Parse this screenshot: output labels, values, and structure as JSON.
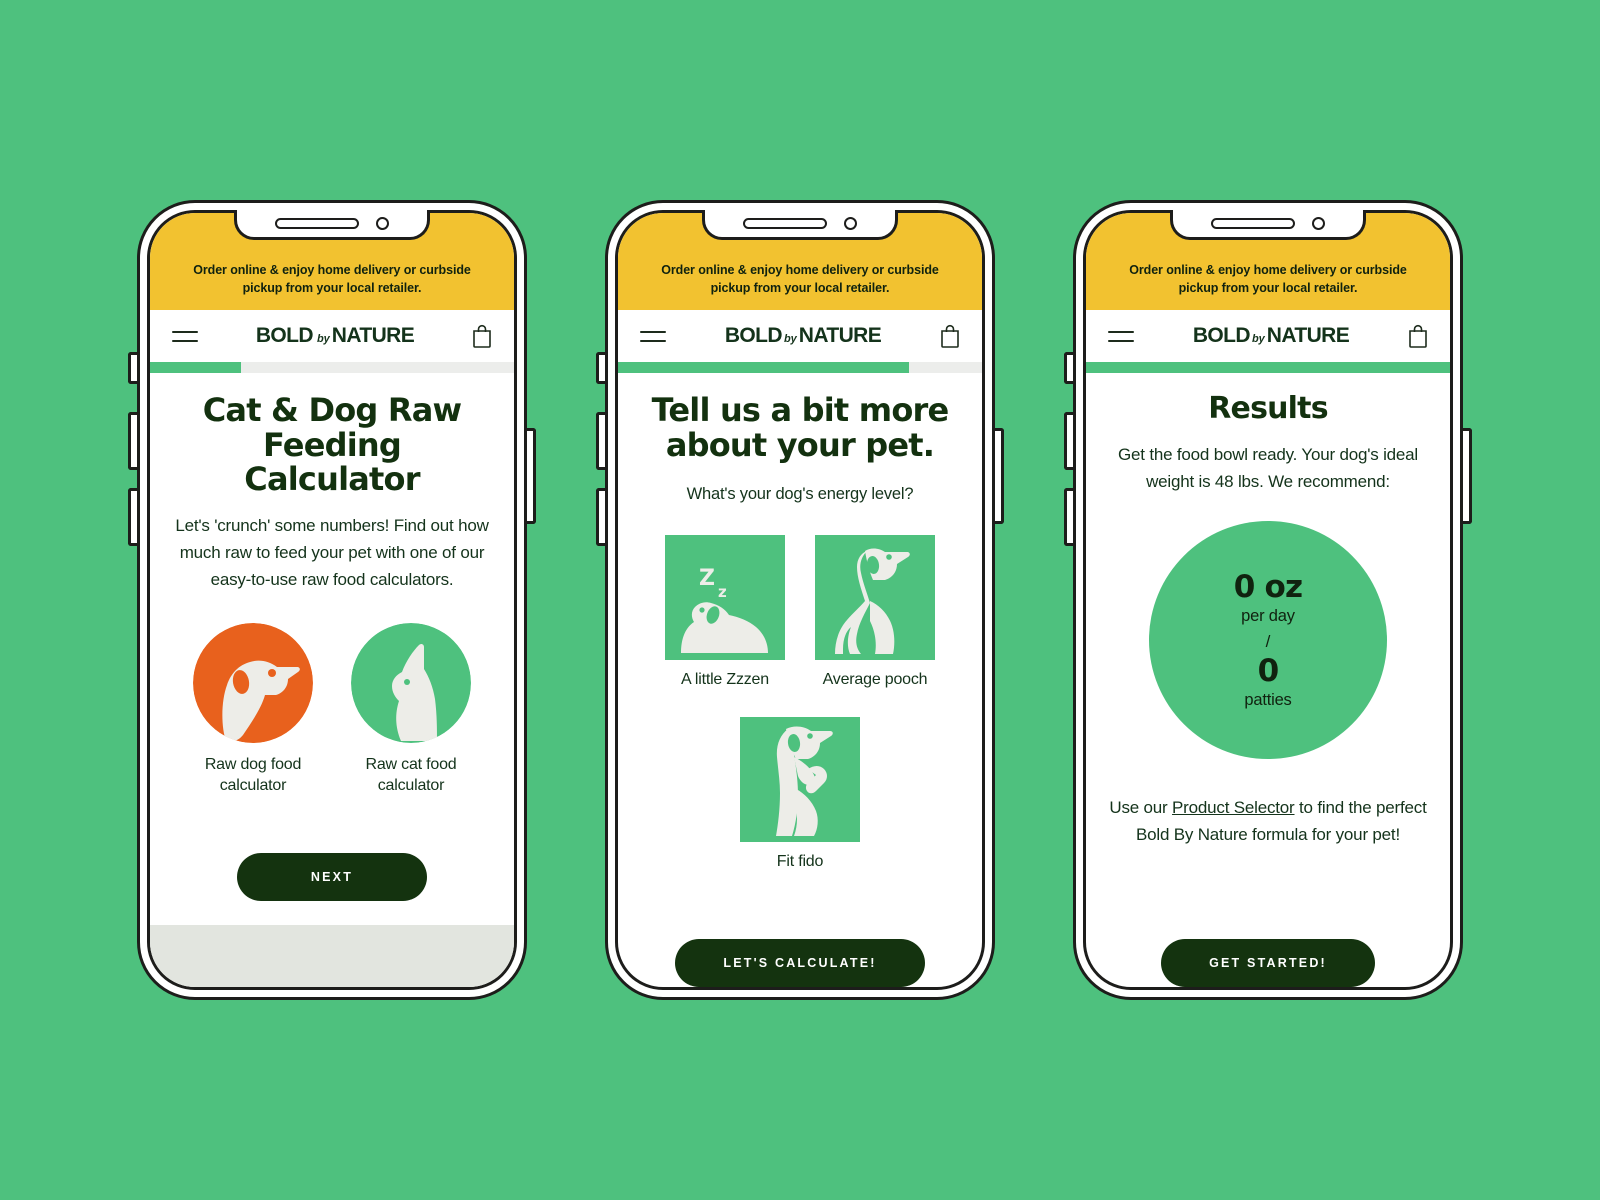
{
  "page": {
    "background_color": "#4EC17E",
    "brand": {
      "logo_bold": "BOLD",
      "logo_by": "by",
      "logo_nature": "NATURE",
      "dark_green": "#14331B",
      "accent_green": "#4EC17E",
      "accent_yellow": "#F2C230",
      "accent_orange": "#E8611D",
      "button_green": "#14330F"
    },
    "announcement": "Order online & enjoy home delivery or curbside pickup from your local retailer.",
    "nav_icons": {
      "menu": "hamburger-icon",
      "cart": "shopping-bag-icon"
    }
  },
  "screens": [
    {
      "id": "calculator-intro",
      "progress_percent": 25,
      "title": "Cat & Dog Raw Feeding Calculator",
      "lede": "Let's 'crunch' some numbers! Find out how much raw to feed your pet with one of our easy-to-use raw food calculators.",
      "choices": [
        {
          "label": "Raw dog food calculator",
          "icon": "dog-head-icon",
          "circle_color": "#E8611D"
        },
        {
          "label": "Raw cat food calculator",
          "icon": "cat-head-icon",
          "circle_color": "#4EC17E"
        }
      ],
      "cta": "NEXT",
      "has_home_bar": true
    },
    {
      "id": "pet-details",
      "progress_percent": 80,
      "title": "Tell us a bit more about your pet.",
      "question": "What's your dog's energy level?",
      "options": [
        {
          "label": "A little Zzzen",
          "icon": "sleeping-dog-icon",
          "badge": "Z z"
        },
        {
          "label": "Average pooch",
          "icon": "sitting-dog-icon"
        },
        {
          "label": "Fit fido",
          "icon": "jumping-dog-icon"
        }
      ],
      "cta": "LET'S CALCULATE!",
      "has_home_bar": false
    },
    {
      "id": "results",
      "progress_percent": 100,
      "title": "Results",
      "lede": "Get the food bowl ready. Your dog's ideal weight is 48 lbs. We recommend:",
      "result": {
        "amount": "0 oz",
        "amount_unit": "per day",
        "divider": "/",
        "count": "0",
        "count_unit": "patties"
      },
      "footer_prefix": "Use our ",
      "footer_link": "Product Selector",
      "footer_suffix": " to find the perfect Bold By Nature formula for your pet!",
      "cta": "GET STARTED!",
      "has_home_bar": false
    }
  ]
}
